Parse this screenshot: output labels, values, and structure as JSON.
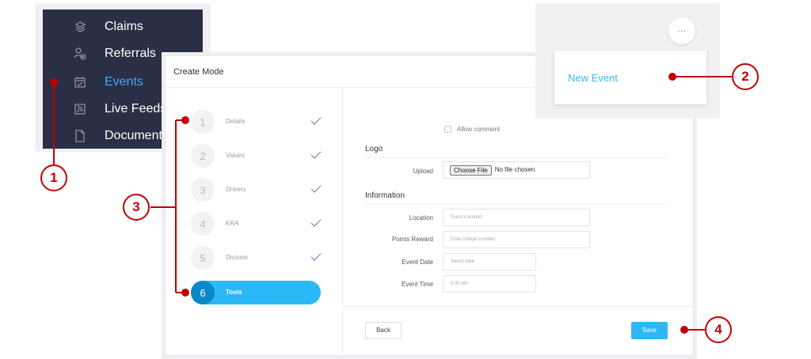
{
  "sidebar": {
    "items": [
      {
        "label": "Claims",
        "icon": "layers-icon",
        "active": false
      },
      {
        "label": "Referrals",
        "icon": "referral-icon",
        "active": false
      },
      {
        "label": "Events",
        "icon": "calendar-check-icon",
        "active": true
      },
      {
        "label": "Live Feeds",
        "icon": "rss-icon",
        "active": false
      },
      {
        "label": "Documents",
        "icon": "document-icon",
        "active": false
      }
    ]
  },
  "card": {
    "title": "Create Mode"
  },
  "steps": [
    {
      "num": "1",
      "label": "Details",
      "done": true
    },
    {
      "num": "2",
      "label": "Values",
      "done": true
    },
    {
      "num": "3",
      "label": "Drivers",
      "done": true
    },
    {
      "num": "4",
      "label": "KRA",
      "done": true
    },
    {
      "num": "5",
      "label": "Division",
      "done": true
    },
    {
      "num": "6",
      "label": "Tools",
      "active": true
    }
  ],
  "form": {
    "allow_comment": "Allow comment",
    "logo_section": "Logo",
    "upload_label": "Upload",
    "choose_file": "Choose File",
    "no_file": "No file chosen",
    "information_section": "Information",
    "location_label": "Location",
    "location_placeholder": "Event Location",
    "points_label": "Points Reward",
    "points_placeholder": "Enter integer number",
    "date_label": "Event Date",
    "date_placeholder": "Select date",
    "time_label": "Event Time",
    "time_placeholder": "8:00 am"
  },
  "footer": {
    "back": "Back",
    "save": "Save"
  },
  "popover": {
    "more": "...",
    "new_event": "New Event"
  },
  "callouts": [
    "1",
    "2",
    "3",
    "4"
  ],
  "colors": {
    "sidebar_bg": "#2a2f45",
    "accent": "#2cb8f6",
    "active_text": "#3fa8f4",
    "callout": "#c00000"
  }
}
